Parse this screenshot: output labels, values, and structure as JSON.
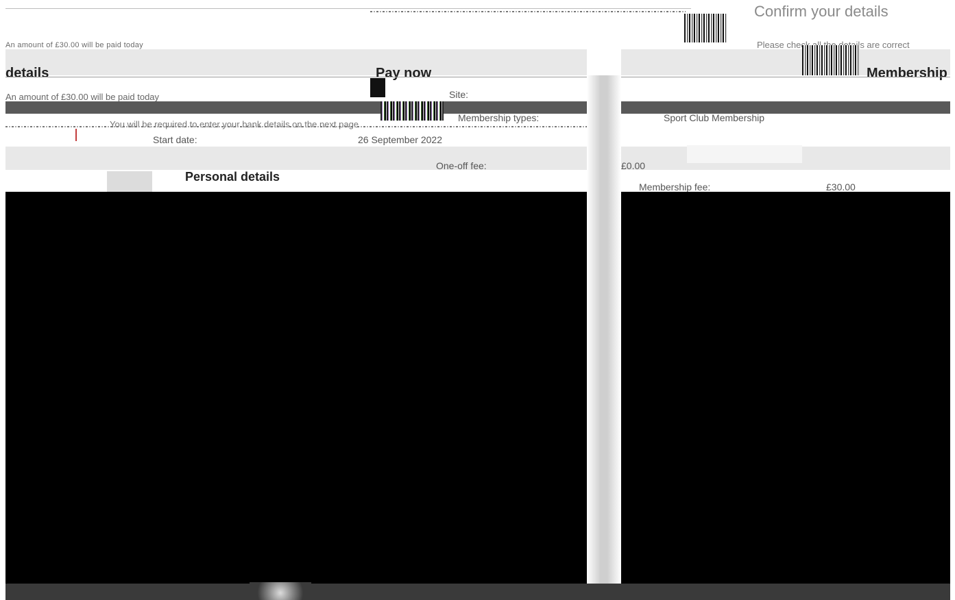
{
  "header": {
    "steps": {
      "details": "details",
      "pay_now": "Pay now",
      "membership": "Membership",
      "confirm": "Confirm your details"
    },
    "instruction": "Please check all the details are correct"
  },
  "intro_line": "An amount of £30.00 will be paid today",
  "bank_notice": "You will be required to enter your bank details on the next page",
  "summary": {
    "site_label": "Site:",
    "membership_types_label": "Membership types:",
    "membership_types_value": "Sport Club Membership",
    "start_date_label": "Start date:",
    "start_date_value": "26 September 2022",
    "one_off_fee_label": "One-off fee:",
    "one_off_fee_value": "£0.00",
    "membership_fee_label": "Membership fee:",
    "membership_fee_value": "£30.00"
  },
  "section": {
    "personal_details_title": "Personal details"
  }
}
